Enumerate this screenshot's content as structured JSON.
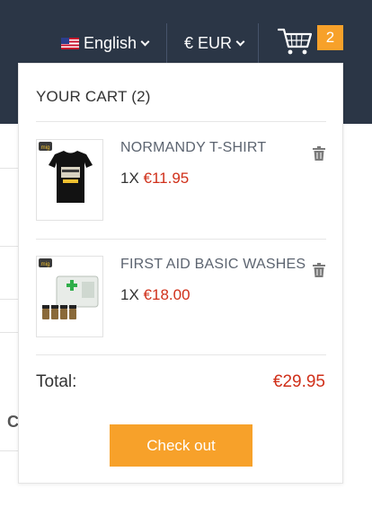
{
  "header": {
    "language": "English",
    "currency": "€ EUR",
    "cart_count": "2"
  },
  "background": {
    "partial_letter": "C"
  },
  "cart": {
    "title": "YOUR CART (2)",
    "items": [
      {
        "name": "NORMANDY T-SHIRT",
        "qty": "1X",
        "price": "€11.95",
        "thumb_badge": "mig"
      },
      {
        "name": "FIRST AID BASIC WASHES",
        "qty": "1X",
        "price": "€18.00",
        "thumb_badge": "mig"
      }
    ],
    "total_label": "Total:",
    "total_value": "€29.95",
    "checkout_label": "Check out"
  },
  "colors": {
    "header_bg": "#2b3646",
    "accent": "#f7a12a",
    "price": "#d0301a"
  },
  "icons": [
    "us-flag-icon",
    "chevron-down-icon",
    "shopping-cart-icon",
    "trash-icon"
  ]
}
